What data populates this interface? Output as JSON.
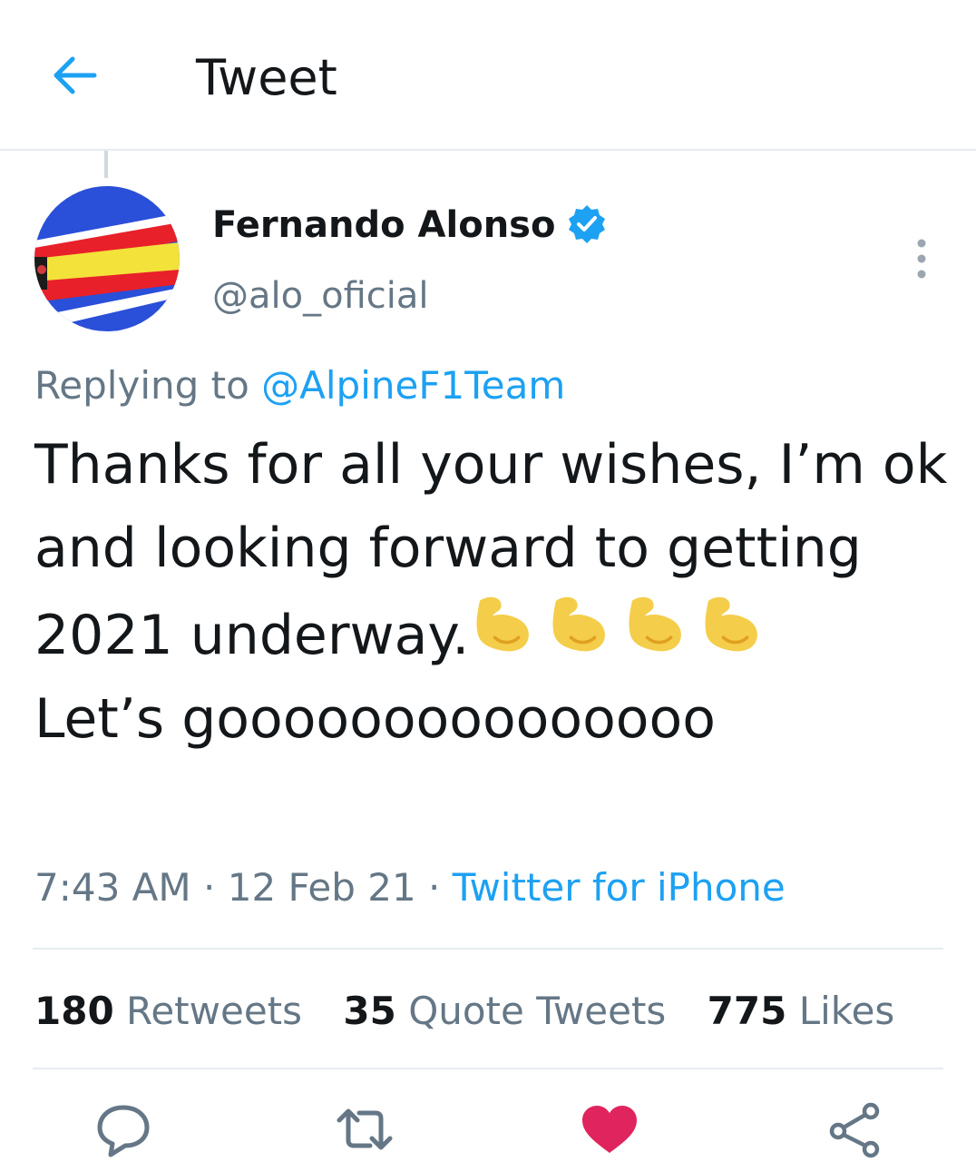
{
  "header": {
    "title": "Tweet",
    "back_icon": "arrow-left-icon"
  },
  "author": {
    "name": "Fernando Alonso",
    "handle": "@alo_oficial",
    "verified": true,
    "verified_icon": "verified-badge-icon",
    "avatar": "avatar"
  },
  "reply": {
    "prefix": "Replying to",
    "mention": "@AlpineF1Team"
  },
  "tweet": {
    "text_line1": "Thanks for all your wishes, I’m ok and looking forward to getting 2021 underway.",
    "emoji": "💪",
    "emoji_icon": "flexed-biceps-icon",
    "text_line2": "Let’s gooooooooooooooo"
  },
  "meta": {
    "time": "7:43 AM",
    "date": "12 Feb 21",
    "source": "Twitter for iPhone",
    "separator": "·"
  },
  "stats": {
    "retweets": {
      "count": "180",
      "label": "Retweets"
    },
    "quote_tweets": {
      "count": "35",
      "label": "Quote Tweets"
    },
    "likes": {
      "count": "775",
      "label": "Likes"
    }
  },
  "actions": {
    "reply_icon": "reply-icon",
    "retweet_icon": "retweet-icon",
    "like_icon": "heart-icon",
    "share_icon": "share-icon",
    "liked": true
  },
  "colors": {
    "accent": "#1da1f2",
    "text": "#14171a",
    "secondary": "#657786",
    "like": "#e0245e",
    "divider": "#e6ecf0"
  }
}
